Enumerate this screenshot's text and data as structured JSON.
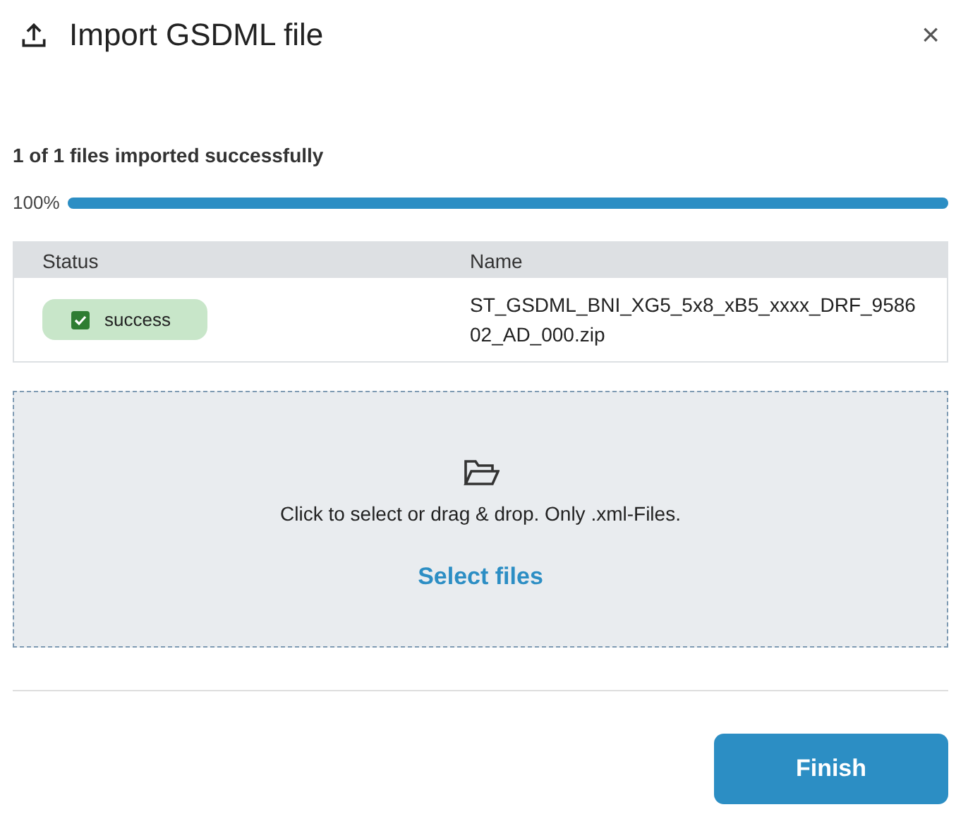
{
  "dialog": {
    "title": "Import GSDML file",
    "close": "×"
  },
  "summary": "1 of 1 files imported successfully",
  "progress": {
    "reading": "100%",
    "level": 1
  },
  "table": {
    "columns": [
      "Status",
      "Name"
    ],
    "rows": [
      {
        "status": "success",
        "checked": true,
        "name": "ST_GSDML_BNI_XG5_5x8_xB5_xxxx_DRF_958602_AD_000.zip"
      }
    ]
  },
  "dropzone": {
    "hint": "Click to select or drag & drop. Only .xml-Files.",
    "link": "Select files"
  },
  "buttons": [
    {
      "label": "Finish"
    }
  ]
}
